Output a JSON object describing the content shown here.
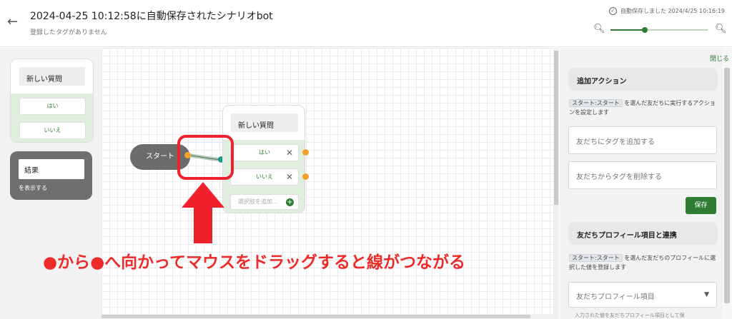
{
  "header": {
    "back_icon": "arrow-left-icon",
    "title": "2024-04-25 10:12:58に自動保存されたシナリオbot",
    "subtitle": "登録したタグがありません",
    "autosave_text": "自動保存しました 2024/4/25 10:16:19",
    "zoom_level": 0.35
  },
  "palette": {
    "question_card": {
      "title": "新しい質問",
      "options": [
        "はい",
        "いいえ"
      ]
    },
    "result_card": {
      "title": "結果",
      "description": "を表示する"
    }
  },
  "canvas": {
    "start_label": "スタート",
    "question_node": {
      "title": "新しい質問",
      "options": [
        "はい",
        "いいえ"
      ],
      "add_option_placeholder": "選択肢を追加..."
    },
    "annotation": "●から●へ向かってマウスをドラッグすると線がつながる",
    "colors": {
      "accent": "#2e7d32",
      "annotation": "#ee2b2b",
      "port": "#f2a12e",
      "connector": "#1a9b8a"
    }
  },
  "panel": {
    "close_label": "閉じる",
    "section1": {
      "title": "追加アクション",
      "chip": "スタート:スタート",
      "description": "を選んだ友だちに実行するアクションを設定します",
      "add_tag_placeholder": "友だちにタグを追加する",
      "remove_tag_placeholder": "友だちからタグを削除する",
      "save_label": "保存"
    },
    "section2": {
      "title": "友だちプロフィール項目と連携",
      "chip": "スタート:スタート",
      "description": "を選んだ友だちのプロフィールに選択した値を登録します",
      "select_placeholder": "友だちプロフィール項目",
      "hint": "入力された値を友だちプロフィール項目として保"
    }
  }
}
